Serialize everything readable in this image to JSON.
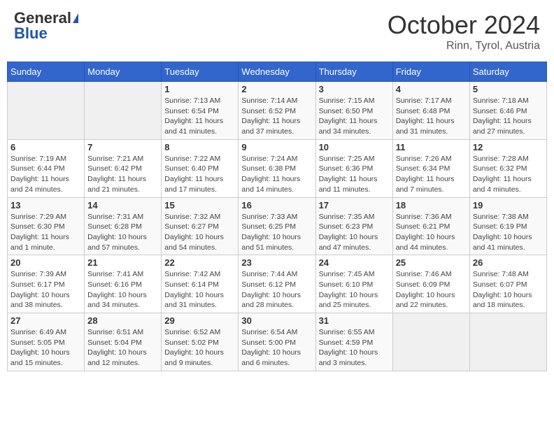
{
  "header": {
    "logo_general": "General",
    "logo_blue": "Blue",
    "month": "October 2024",
    "location": "Rinn, Tyrol, Austria"
  },
  "days_of_week": [
    "Sunday",
    "Monday",
    "Tuesday",
    "Wednesday",
    "Thursday",
    "Friday",
    "Saturday"
  ],
  "weeks": [
    [
      {
        "day": "",
        "info": ""
      },
      {
        "day": "",
        "info": ""
      },
      {
        "day": "1",
        "info": "Sunrise: 7:13 AM\nSunset: 6:54 PM\nDaylight: 11 hours and 41 minutes."
      },
      {
        "day": "2",
        "info": "Sunrise: 7:14 AM\nSunset: 6:52 PM\nDaylight: 11 hours and 37 minutes."
      },
      {
        "day": "3",
        "info": "Sunrise: 7:15 AM\nSunset: 6:50 PM\nDaylight: 11 hours and 34 minutes."
      },
      {
        "day": "4",
        "info": "Sunrise: 7:17 AM\nSunset: 6:48 PM\nDaylight: 11 hours and 31 minutes."
      },
      {
        "day": "5",
        "info": "Sunrise: 7:18 AM\nSunset: 6:46 PM\nDaylight: 11 hours and 27 minutes."
      }
    ],
    [
      {
        "day": "6",
        "info": "Sunrise: 7:19 AM\nSunset: 6:44 PM\nDaylight: 11 hours and 24 minutes."
      },
      {
        "day": "7",
        "info": "Sunrise: 7:21 AM\nSunset: 6:42 PM\nDaylight: 11 hours and 21 minutes."
      },
      {
        "day": "8",
        "info": "Sunrise: 7:22 AM\nSunset: 6:40 PM\nDaylight: 11 hours and 17 minutes."
      },
      {
        "day": "9",
        "info": "Sunrise: 7:24 AM\nSunset: 6:38 PM\nDaylight: 11 hours and 14 minutes."
      },
      {
        "day": "10",
        "info": "Sunrise: 7:25 AM\nSunset: 6:36 PM\nDaylight: 11 hours and 11 minutes."
      },
      {
        "day": "11",
        "info": "Sunrise: 7:26 AM\nSunset: 6:34 PM\nDaylight: 11 hours and 7 minutes."
      },
      {
        "day": "12",
        "info": "Sunrise: 7:28 AM\nSunset: 6:32 PM\nDaylight: 11 hours and 4 minutes."
      }
    ],
    [
      {
        "day": "13",
        "info": "Sunrise: 7:29 AM\nSunset: 6:30 PM\nDaylight: 11 hours and 1 minute."
      },
      {
        "day": "14",
        "info": "Sunrise: 7:31 AM\nSunset: 6:28 PM\nDaylight: 10 hours and 57 minutes."
      },
      {
        "day": "15",
        "info": "Sunrise: 7:32 AM\nSunset: 6:27 PM\nDaylight: 10 hours and 54 minutes."
      },
      {
        "day": "16",
        "info": "Sunrise: 7:33 AM\nSunset: 6:25 PM\nDaylight: 10 hours and 51 minutes."
      },
      {
        "day": "17",
        "info": "Sunrise: 7:35 AM\nSunset: 6:23 PM\nDaylight: 10 hours and 47 minutes."
      },
      {
        "day": "18",
        "info": "Sunrise: 7:36 AM\nSunset: 6:21 PM\nDaylight: 10 hours and 44 minutes."
      },
      {
        "day": "19",
        "info": "Sunrise: 7:38 AM\nSunset: 6:19 PM\nDaylight: 10 hours and 41 minutes."
      }
    ],
    [
      {
        "day": "20",
        "info": "Sunrise: 7:39 AM\nSunset: 6:17 PM\nDaylight: 10 hours and 38 minutes."
      },
      {
        "day": "21",
        "info": "Sunrise: 7:41 AM\nSunset: 6:16 PM\nDaylight: 10 hours and 34 minutes."
      },
      {
        "day": "22",
        "info": "Sunrise: 7:42 AM\nSunset: 6:14 PM\nDaylight: 10 hours and 31 minutes."
      },
      {
        "day": "23",
        "info": "Sunrise: 7:44 AM\nSunset: 6:12 PM\nDaylight: 10 hours and 28 minutes."
      },
      {
        "day": "24",
        "info": "Sunrise: 7:45 AM\nSunset: 6:10 PM\nDaylight: 10 hours and 25 minutes."
      },
      {
        "day": "25",
        "info": "Sunrise: 7:46 AM\nSunset: 6:09 PM\nDaylight: 10 hours and 22 minutes."
      },
      {
        "day": "26",
        "info": "Sunrise: 7:48 AM\nSunset: 6:07 PM\nDaylight: 10 hours and 18 minutes."
      }
    ],
    [
      {
        "day": "27",
        "info": "Sunrise: 6:49 AM\nSunset: 5:05 PM\nDaylight: 10 hours and 15 minutes."
      },
      {
        "day": "28",
        "info": "Sunrise: 6:51 AM\nSunset: 5:04 PM\nDaylight: 10 hours and 12 minutes."
      },
      {
        "day": "29",
        "info": "Sunrise: 6:52 AM\nSunset: 5:02 PM\nDaylight: 10 hours and 9 minutes."
      },
      {
        "day": "30",
        "info": "Sunrise: 6:54 AM\nSunset: 5:00 PM\nDaylight: 10 hours and 6 minutes."
      },
      {
        "day": "31",
        "info": "Sunrise: 6:55 AM\nSunset: 4:59 PM\nDaylight: 10 hours and 3 minutes."
      },
      {
        "day": "",
        "info": ""
      },
      {
        "day": "",
        "info": ""
      }
    ]
  ]
}
